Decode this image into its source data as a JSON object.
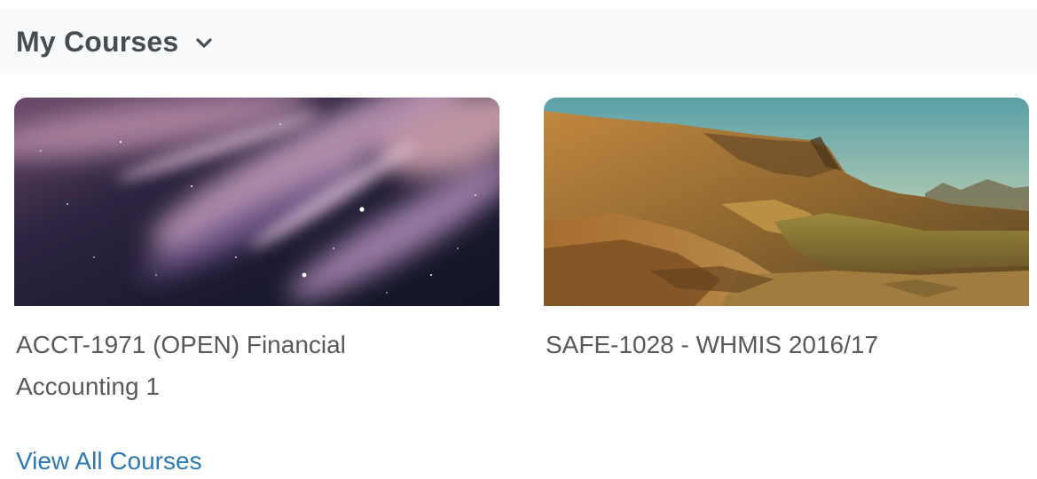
{
  "widget": {
    "title": "My Courses",
    "view_all_label": "View All Courses"
  },
  "courses": [
    {
      "title": "ACCT-1971 (OPEN) Financial Accounting 1",
      "image_icon": "night-sky-image"
    },
    {
      "title": "SAFE-1028 - WHMIS 2016/17",
      "image_icon": "mountain-landscape-image"
    }
  ],
  "colors": {
    "header_bg": "#f9fafb",
    "title_text": "#494c4e",
    "course_text": "#565a5c",
    "link": "#2d79b3"
  }
}
